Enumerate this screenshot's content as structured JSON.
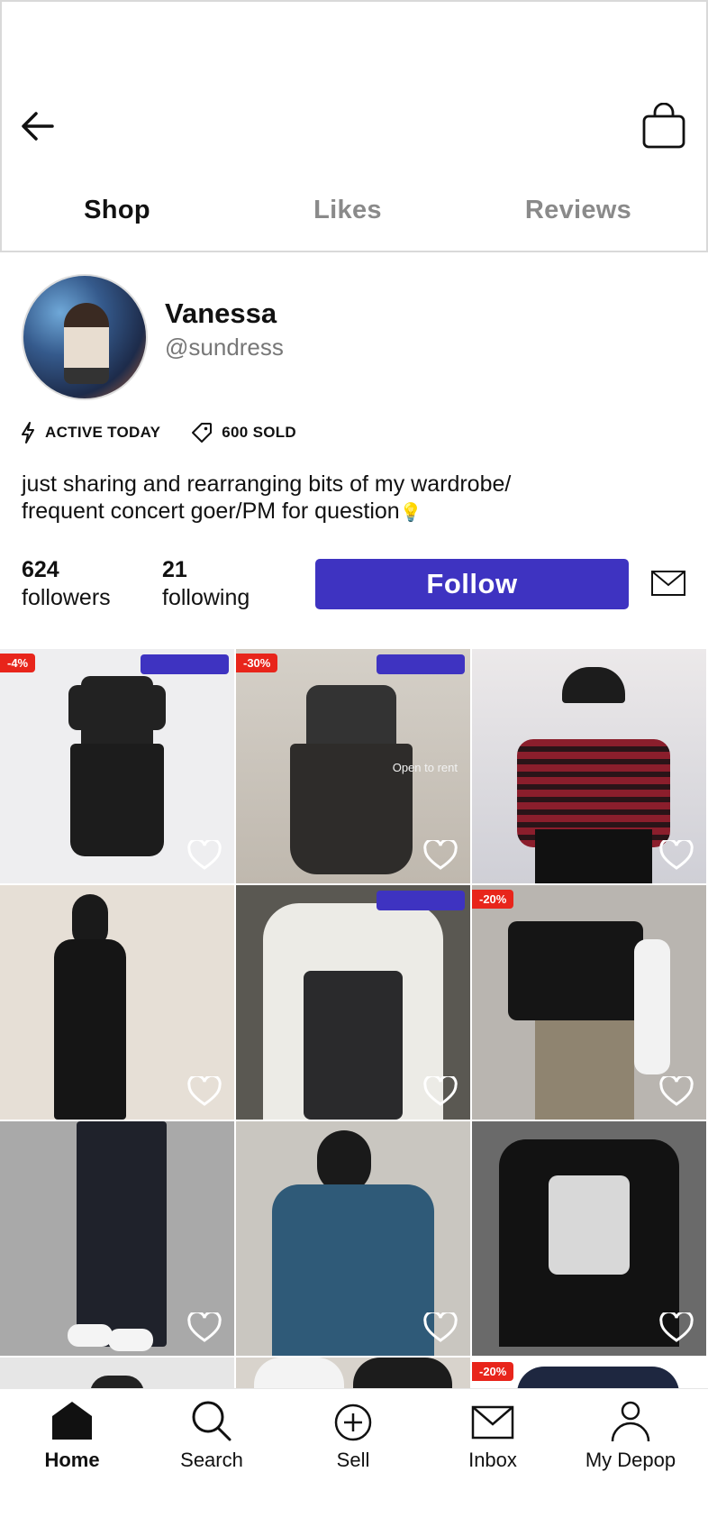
{
  "header": {
    "back_icon": "arrow-left-icon",
    "bag_icon": "shopping-bag-icon",
    "tabs": [
      {
        "label": "Shop",
        "active": true
      },
      {
        "label": "Likes",
        "active": false
      },
      {
        "label": "Reviews",
        "active": false
      }
    ]
  },
  "profile": {
    "name": "Vanessa",
    "handle": "@sundress",
    "active_label": "ACTIVE TODAY",
    "sold_label": "600 SOLD",
    "bio_line1": "just sharing and rearranging bits of my wardrobe/",
    "bio_line2": "frequent concert goer/PM for question",
    "bio_emoji": "💡",
    "followers_count": "624",
    "followers_label": "followers",
    "following_count": "21",
    "following_label": "following",
    "follow_button": "Follow"
  },
  "grid": {
    "items": [
      {
        "badge": "-4%",
        "promo_tag": true,
        "subject": "black collared dress"
      },
      {
        "badge": "-30%",
        "promo_tag": true,
        "overlay_text": "Open to rent",
        "subject": "black quilted dress on hanger"
      },
      {
        "badge": "",
        "promo_tag": false,
        "subject": "striped sweater with cap"
      },
      {
        "badge": "",
        "promo_tag": false,
        "subject": "black slip dress"
      },
      {
        "badge": "",
        "promo_tag": true,
        "subject": "white blouse with black corset"
      },
      {
        "badge": "-20%",
        "promo_tag": false,
        "subject": "graphic crop top and cargo pants"
      },
      {
        "badge": "",
        "promo_tag": false,
        "subject": "black track pants"
      },
      {
        "badge": "",
        "promo_tag": false,
        "subject": "blue oversized tee"
      },
      {
        "badge": "",
        "promo_tag": false,
        "subject": "black anime graphic tee"
      },
      {
        "badge": "",
        "promo_tag": false,
        "subject": "partial item"
      },
      {
        "badge": "",
        "promo_tag": false,
        "subject": "partial item"
      },
      {
        "badge": "-20%",
        "promo_tag": false,
        "subject": "partial item"
      }
    ]
  },
  "bottom_nav": [
    {
      "label": "Home",
      "icon": "home-icon",
      "active": true
    },
    {
      "label": "Search",
      "icon": "search-icon",
      "active": false
    },
    {
      "label": "Sell",
      "icon": "plus-circle-icon",
      "active": false
    },
    {
      "label": "Inbox",
      "icon": "envelope-icon",
      "active": false
    },
    {
      "label": "My Depop",
      "icon": "person-icon",
      "active": false
    }
  ],
  "colors": {
    "brand_blue": "#3e33c1",
    "sale_red": "#e8251b"
  }
}
